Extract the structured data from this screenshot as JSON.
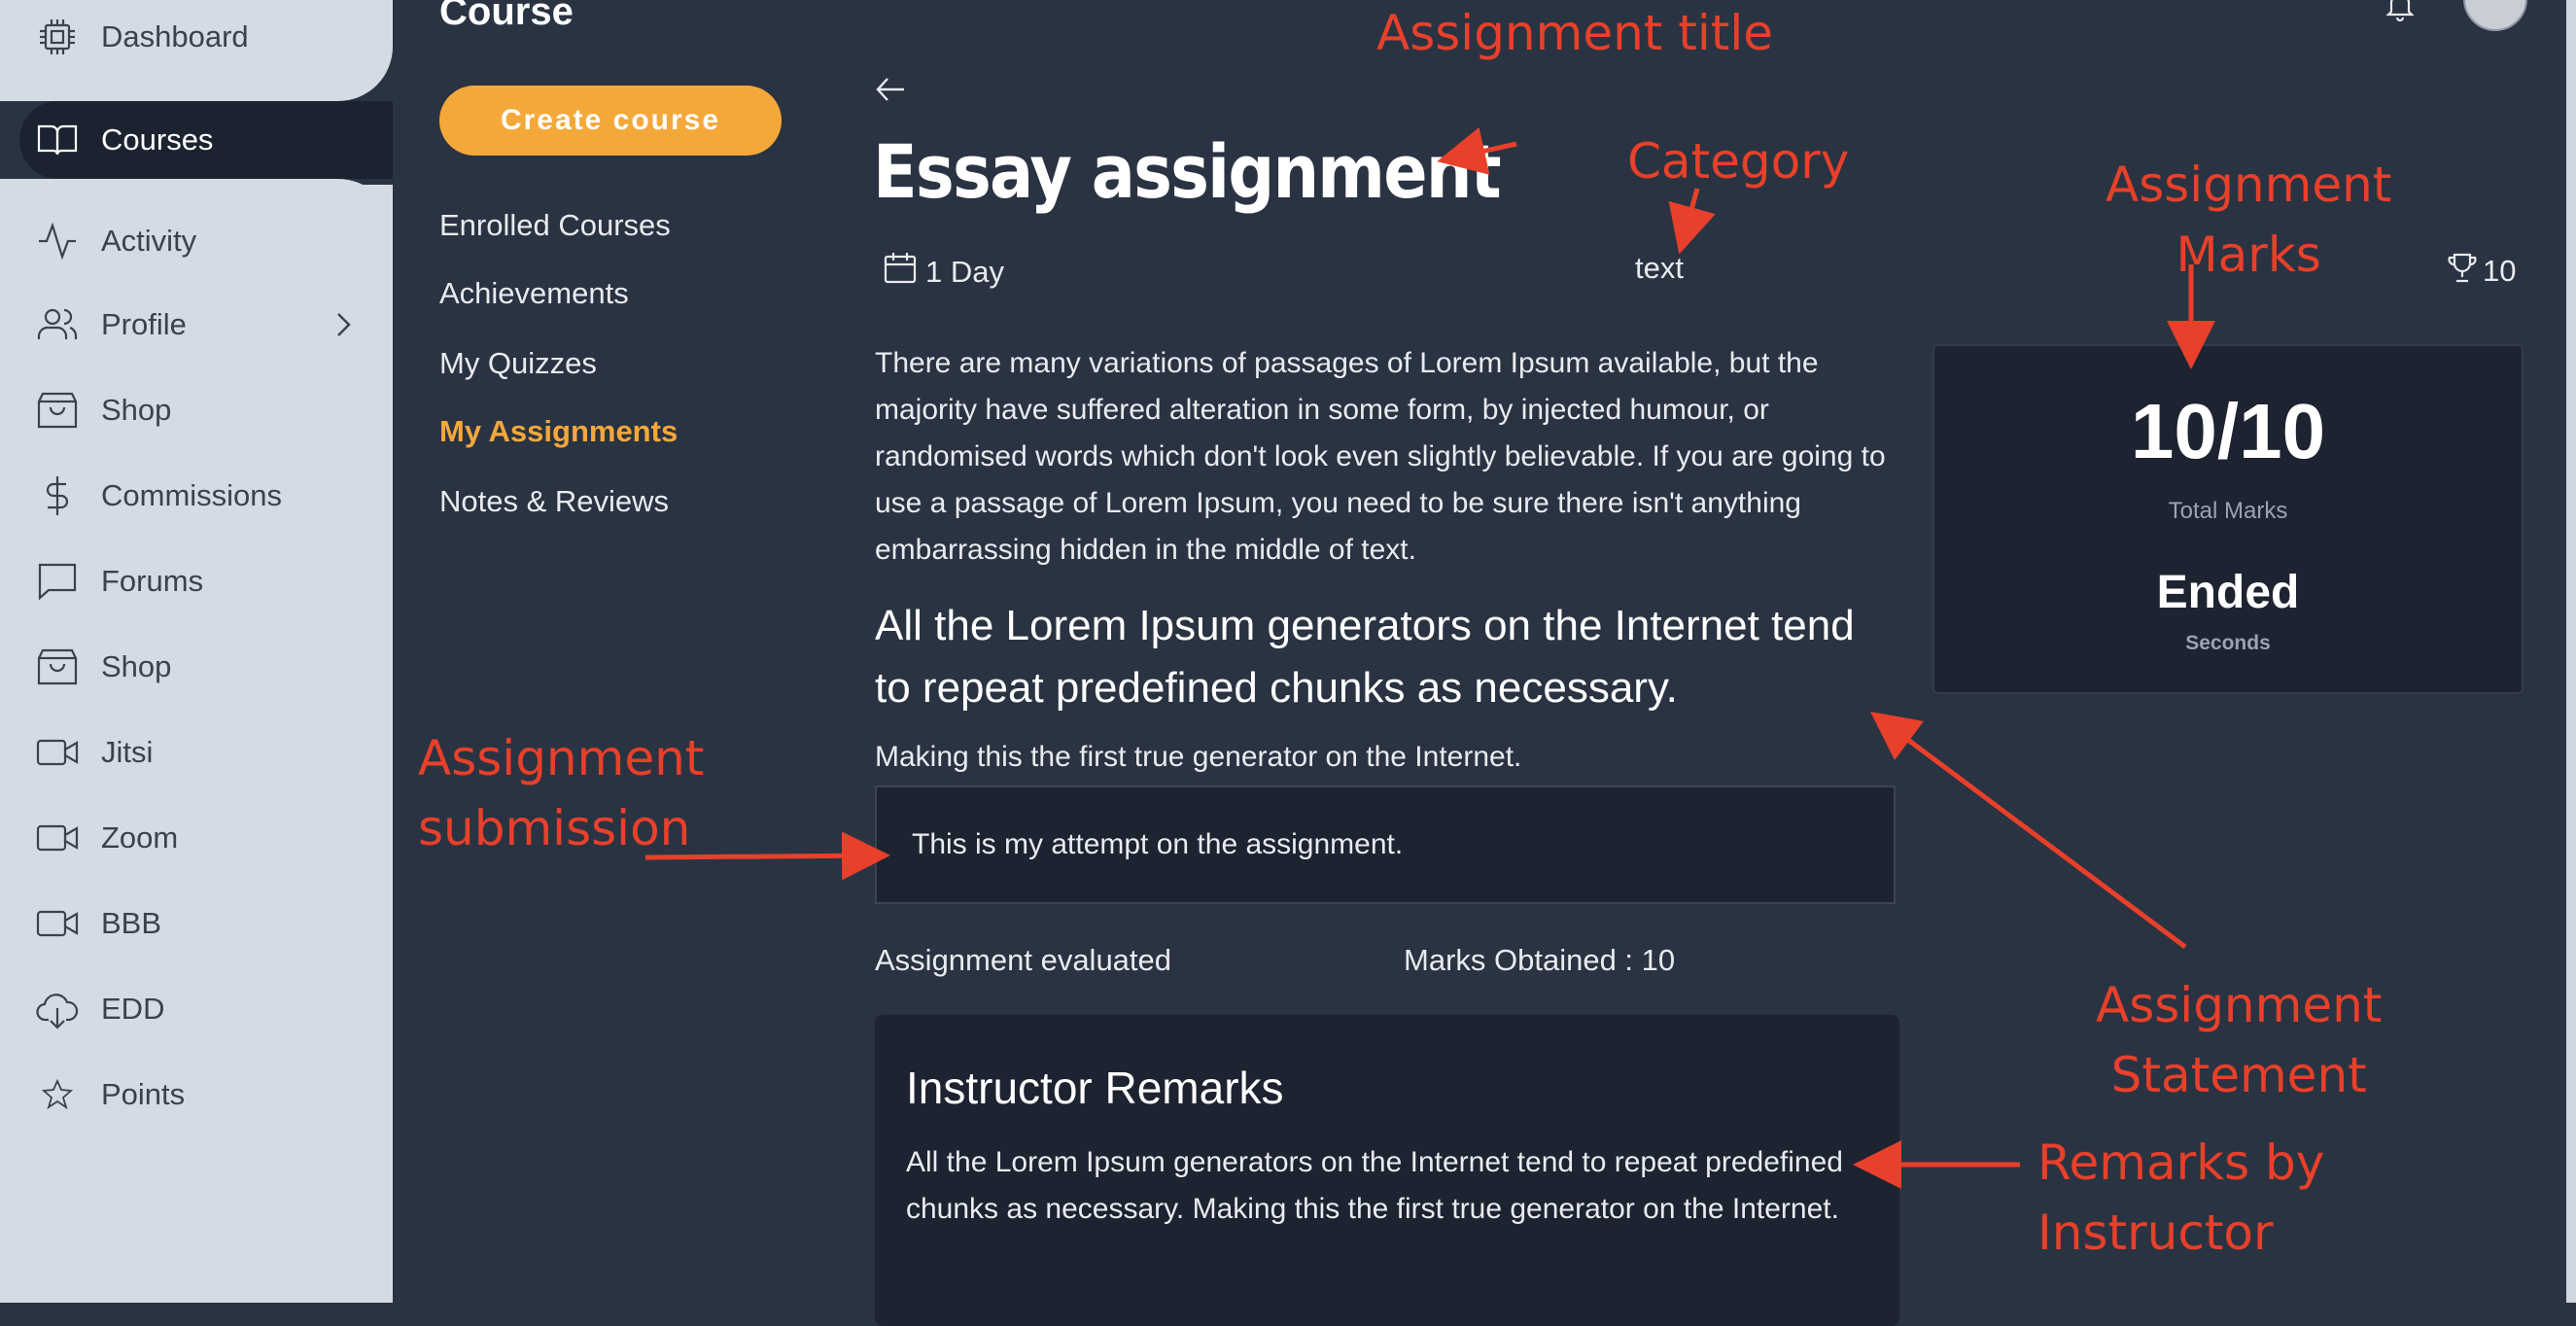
{
  "sidebar": {
    "items": [
      {
        "label": "Dashboard",
        "icon": "chip-icon"
      },
      {
        "label": "Courses",
        "icon": "book-icon",
        "active": true
      },
      {
        "label": "Activity",
        "icon": "activity-icon"
      },
      {
        "label": "Profile",
        "icon": "users-icon"
      },
      {
        "label": "Shop",
        "icon": "shopping-bag-icon"
      },
      {
        "label": "Commissions",
        "icon": "dollar-icon"
      },
      {
        "label": "Forums",
        "icon": "chat-icon"
      },
      {
        "label": "Shop",
        "icon": "shopping-bag-icon"
      },
      {
        "label": "Jitsi",
        "icon": "video-icon"
      },
      {
        "label": "Zoom",
        "icon": "video-icon"
      },
      {
        "label": "BBB",
        "icon": "video-icon"
      },
      {
        "label": "EDD",
        "icon": "cloud-download-icon"
      },
      {
        "label": "Points",
        "icon": "star-icon"
      }
    ]
  },
  "course_menu": {
    "title": "Course",
    "create_button": "Create course",
    "links": [
      "Enrolled Courses",
      "Achievements",
      "My Quizzes",
      "My Assignments",
      "Notes & Reviews"
    ],
    "active_link": "My Assignments"
  },
  "assignment": {
    "title": "Essay assignment",
    "duration": "1 Day",
    "category": "text",
    "points": "10",
    "description": "There are many variations of passages of Lorem Ipsum available, but the majority have suffered alteration in some form, by injected humour, or randomised words which don't look even slightly believable. If you are going to use a passage of Lorem Ipsum, you need to be sure there isn't anything embarrassing hidden in the middle of text.",
    "statement": "All the Lorem Ipsum generators on the Internet tend to repeat predefined chunks as necessary.",
    "statement_sub": "Making this the first true generator on the Internet.",
    "submission": "This is my attempt on the assignment.",
    "evaluation_status": "Assignment evaluated",
    "marks_obtained": "Marks Obtained : 10",
    "remarks_title": "Instructor Remarks",
    "remarks_text": "All the Lorem Ipsum generators on the Internet tend to repeat predefined chunks as necessary. Making this the first true generator on the Internet."
  },
  "marks_card": {
    "marks": "10/10",
    "marks_label": "Total Marks",
    "status": "Ended",
    "status_label": "Seconds"
  },
  "annotations": {
    "title": "Assignment title",
    "category": "Category",
    "marks": "Assignment\nMarks",
    "submission": "Assignment\nsubmission",
    "statement": "Assignment\nStatement",
    "remarks": "Remarks by\nInstructor"
  },
  "colors": {
    "accent": "#f5a83a",
    "annotation": "#e8402a",
    "sidebar_bg": "#d3dbe5",
    "main_bg": "#2a3342",
    "card_bg": "#1d2330"
  }
}
